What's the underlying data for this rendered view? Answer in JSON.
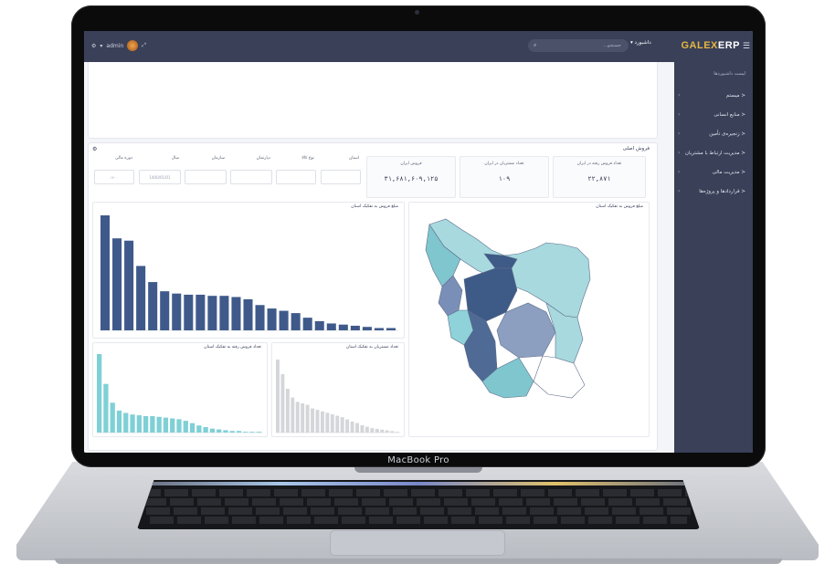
{
  "device": {
    "label": "MacBook Pro"
  },
  "app": {
    "logo_main": "GALEX",
    "logo_suffix": "ERP",
    "search_placeholder": "جستجو...",
    "dashboard_select": "داشبورد",
    "user_name": "admin"
  },
  "sidebar": {
    "header": "لیست داشبوردها",
    "items": [
      {
        "label": "میستم"
      },
      {
        "label": "منابع انسانی"
      },
      {
        "label": "زنجیره‌ی تأمین"
      },
      {
        "label": "مدیریت ارتباط با مشتریان"
      },
      {
        "label": "مدیریت مالی"
      },
      {
        "label": "قراردادها و پروژه‌ها"
      }
    ]
  },
  "sales": {
    "title": "فروش اصلی",
    "kpis": [
      {
        "label": "تعداد فروش رفته در ایران",
        "value": "۲۲,۸۷۱"
      },
      {
        "label": "تعداد مشتریان در ایران",
        "value": "۱۰۹"
      },
      {
        "label": "فروش ایران",
        "value": "۳۱,۶۸۱,۶۰۹,۱۲۵"
      }
    ],
    "filters": [
      {
        "label": "استان",
        "value": ""
      },
      {
        "label": "نوع کالا",
        "value": ""
      },
      {
        "label": "دپارتمان",
        "value": ""
      },
      {
        "label": "سازمان",
        "value": ""
      },
      {
        "label": "سال",
        "value": "1400/01/01"
      },
      {
        "label": "ماه",
        "value": ""
      },
      {
        "label": "دوره مالی",
        "value": "۱۴۰۰"
      }
    ]
  },
  "charts": {
    "map_title": "مبلغ فروش به تفکیک استان",
    "bar_title": "مبلغ فروش به تفکیک استان",
    "qty_title": "تعداد فروش رفته به تفکیک استان",
    "customers_title": "تعداد مشتریان به تفکیک استان"
  },
  "chart_data": [
    {
      "type": "bar",
      "title": "مبلغ فروش به تفکیک استان",
      "values": [
        100,
        80,
        78,
        56,
        42,
        34,
        32,
        31,
        31,
        30,
        30,
        29,
        27,
        22,
        19,
        17,
        15,
        11,
        8,
        6,
        5,
        4,
        3,
        2,
        2
      ],
      "color": "#3f5a8a"
    },
    {
      "type": "bar",
      "title": "تعداد فروش رفته به تفکیک استان",
      "values": [
        100,
        62,
        38,
        28,
        25,
        23,
        22,
        21,
        21,
        20,
        19,
        18,
        17,
        15,
        12,
        9,
        7,
        5,
        4,
        3,
        2,
        2,
        1,
        1,
        1
      ],
      "color": "#7fd0d6"
    },
    {
      "type": "bar",
      "title": "تعداد مشتریان به تفکیک استان",
      "values": [
        100,
        80,
        60,
        48,
        42,
        40,
        38,
        33,
        31,
        29,
        27,
        25,
        23,
        21,
        18,
        15,
        13,
        10,
        8,
        6,
        5,
        4,
        3,
        2,
        1
      ],
      "color": "#d4d6da"
    }
  ]
}
